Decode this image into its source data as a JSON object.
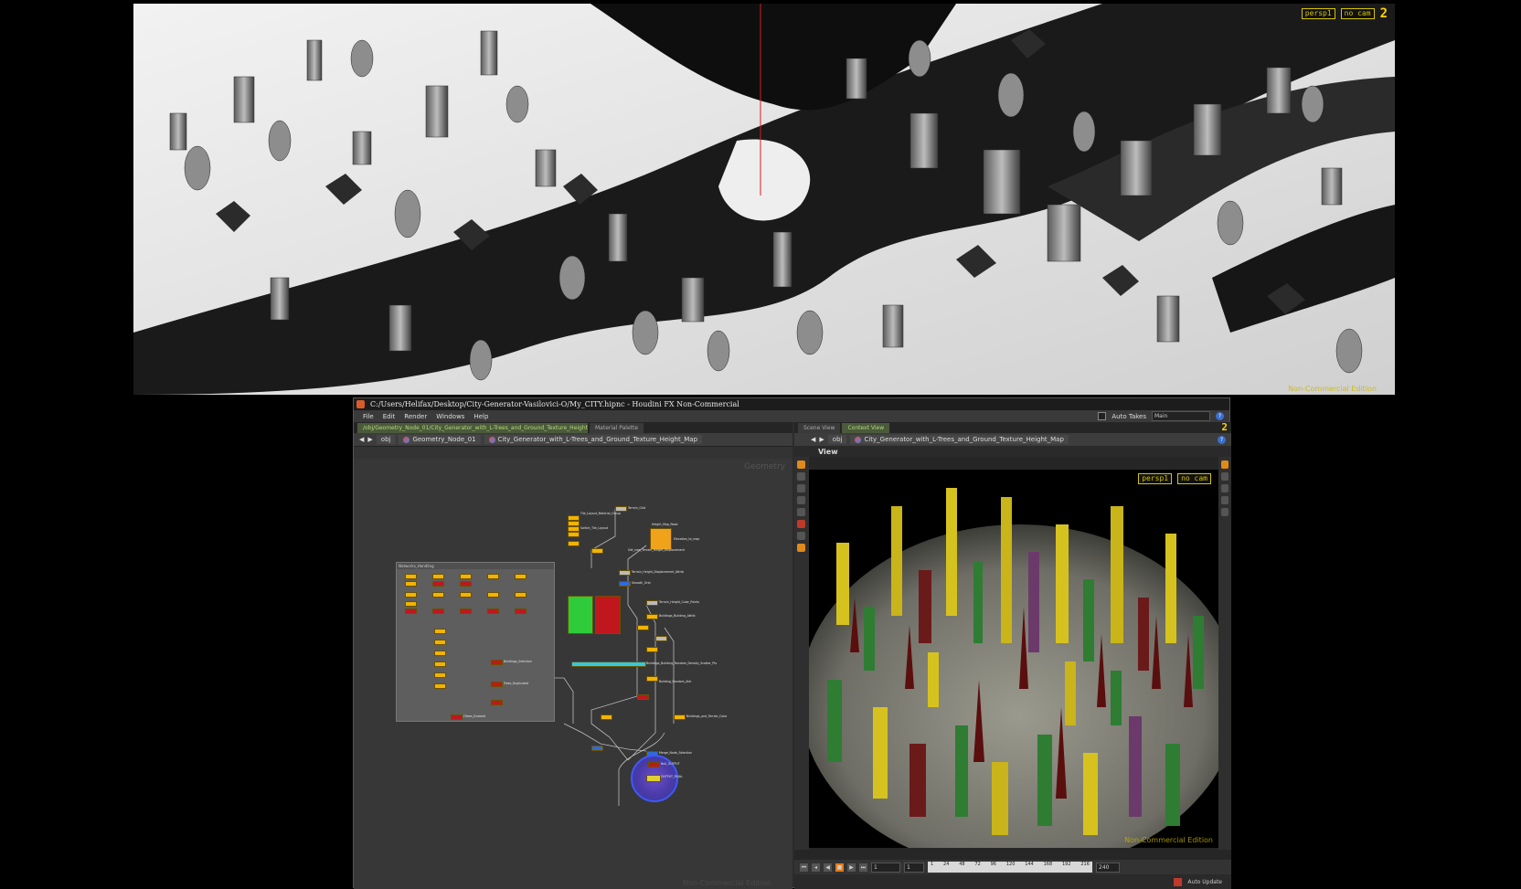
{
  "top_viewport": {
    "camera_label": "persp1",
    "cam_label": "no cam",
    "viewport_number": "2",
    "watermark": "Non-Commercial Edition"
  },
  "window": {
    "title": "C:/Users/Helifax/Desktop/City-Generator-Vasilovici-O/My_CITY.hipnc - Houdini FX Non-Commercial"
  },
  "menu": {
    "items": [
      "File",
      "Edit",
      "Render",
      "Windows",
      "Help"
    ],
    "auto_takes": "Auto Takes",
    "main_take": "Main"
  },
  "left_pane": {
    "tabs": [
      "/obj/Geometry_Node_01/City_Generator_with_L-Trees_and_Ground_Texture_Height_Map",
      "Material Palette"
    ],
    "path": [
      "obj",
      "Geometry_Node_01",
      "City_Generator_with_L-Trees_and_Ground_Texture_Height_Map"
    ],
    "context_label": "Geometry",
    "netbox_title": "Networks_Handling",
    "nodes": [
      "Terrain_Grid",
      "Tile_Layout_Material_Group",
      "Switch_Tile_Layout",
      "Height_Map_Read",
      "Elevation_to_map",
      "Get_new_Terrain_Height_Displacement",
      "Terrain_Height_Displacement_Attrib",
      "Smooth_Grid",
      "Terrain_Height_Color_Points",
      "Buildings_Building_Attrib",
      "Buildings_Building_Random_Density_Scatter_Pts",
      "Building_Random_Attr",
      "Buildings_and_Terrain_Color",
      "Merge_Node_Selection",
      "Null_OUTPUT",
      "OUTPUT_FINAL",
      "LTrees_Enabled",
      "Trees_Duplicated",
      "Buildings_Selection"
    ],
    "watermark": "Non-Commercial Edition"
  },
  "right_pane": {
    "tabs": [
      "Scene View",
      "Context View"
    ],
    "path": [
      "obj",
      "City_Generator_with_L-Trees_and_Ground_Texture_Height_Map"
    ],
    "view_label": "View",
    "camera_label": "persp1",
    "cam_label": "no cam",
    "viewport_number": "2",
    "watermark": "Non-Commercial Edition"
  },
  "timeline": {
    "current_frame": "1",
    "start_frame": "1",
    "end_frame": "240",
    "ticks": [
      "1",
      "24",
      "48",
      "72",
      "96",
      "120",
      "144",
      "168",
      "192",
      "216"
    ],
    "auto_update": "Auto Update"
  }
}
